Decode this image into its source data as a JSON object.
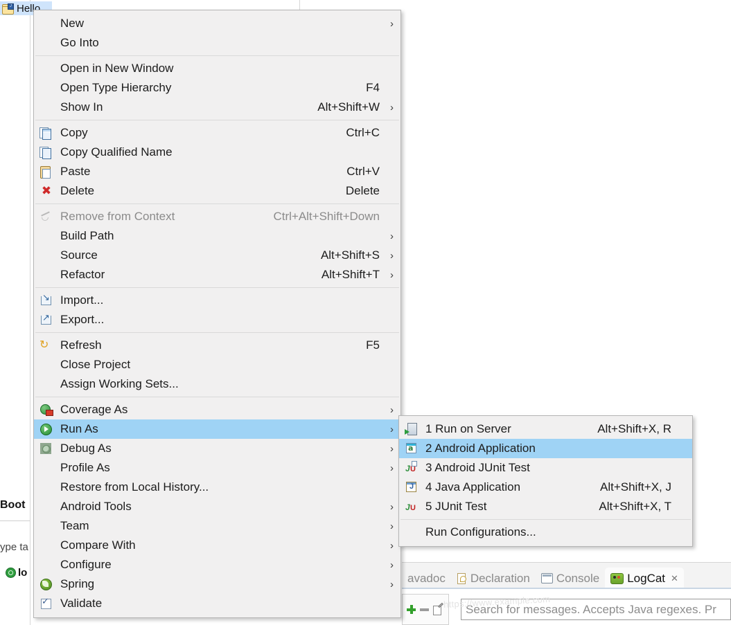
{
  "background": {
    "tree_selected_item": {
      "label": "Hello",
      "icon": "java-project-folder-icon"
    },
    "left_fragments": {
      "boot_label": "Boot",
      "type_label": "ype ta",
      "console_label": "lo",
      "console_icon": "green-circle-icon"
    },
    "view_tabs": [
      {
        "label": "avadoc",
        "icon": "javadoc-icon",
        "active": false,
        "has_close": false
      },
      {
        "label": "Declaration",
        "icon": "declaration-icon",
        "active": false,
        "has_close": false
      },
      {
        "label": "Console",
        "icon": "console-icon",
        "active": false,
        "has_close": false
      },
      {
        "label": "LogCat",
        "icon": "logcat-icon",
        "active": true,
        "has_close": true
      }
    ],
    "tab_close_glyph": "✕",
    "logcat_toolbar": [
      {
        "name": "add-filter-button",
        "icon": "plus-icon"
      },
      {
        "name": "remove-filter-button",
        "icon": "minus-icon"
      },
      {
        "name": "edit-filter-button",
        "icon": "edit-document-icon"
      }
    ],
    "logcat_search_placeholder": "Search for messages. Accepts Java regexes. Pr",
    "watermark": "https://www.example.com"
  },
  "context_menu": {
    "groups": [
      {
        "items": [
          {
            "label": "New",
            "accel": "",
            "submenu": true,
            "icon": "",
            "disabled": false,
            "selected": false
          },
          {
            "label": "Go Into",
            "accel": "",
            "submenu": false,
            "icon": "",
            "disabled": false,
            "selected": false
          }
        ]
      },
      {
        "items": [
          {
            "label": "Open in New Window",
            "accel": "",
            "submenu": false,
            "icon": "",
            "disabled": false,
            "selected": false
          },
          {
            "label": "Open Type Hierarchy",
            "accel": "F4",
            "submenu": false,
            "icon": "",
            "disabled": false,
            "selected": false
          },
          {
            "label": "Show In",
            "accel": "Alt+Shift+W",
            "submenu": true,
            "icon": "",
            "disabled": false,
            "selected": false
          }
        ]
      },
      {
        "items": [
          {
            "label": "Copy",
            "accel": "Ctrl+C",
            "submenu": false,
            "icon": "copy-icon",
            "disabled": false,
            "selected": false
          },
          {
            "label": "Copy Qualified Name",
            "accel": "",
            "submenu": false,
            "icon": "copy-qualified-name-icon",
            "disabled": false,
            "selected": false
          },
          {
            "label": "Paste",
            "accel": "Ctrl+V",
            "submenu": false,
            "icon": "paste-icon",
            "disabled": false,
            "selected": false
          },
          {
            "label": "Delete",
            "accel": "Delete",
            "submenu": false,
            "icon": "delete-x-icon",
            "disabled": false,
            "selected": false
          }
        ]
      },
      {
        "items": [
          {
            "label": "Remove from Context",
            "accel": "Ctrl+Alt+Shift+Down",
            "submenu": false,
            "icon": "remove-from-context-icon",
            "disabled": true,
            "selected": false
          },
          {
            "label": "Build Path",
            "accel": "",
            "submenu": true,
            "icon": "",
            "disabled": false,
            "selected": false
          },
          {
            "label": "Source",
            "accel": "Alt+Shift+S",
            "submenu": true,
            "icon": "",
            "disabled": false,
            "selected": false
          },
          {
            "label": "Refactor",
            "accel": "Alt+Shift+T",
            "submenu": true,
            "icon": "",
            "disabled": false,
            "selected": false
          }
        ]
      },
      {
        "items": [
          {
            "label": "Import...",
            "accel": "",
            "submenu": false,
            "icon": "import-icon",
            "disabled": false,
            "selected": false
          },
          {
            "label": "Export...",
            "accel": "",
            "submenu": false,
            "icon": "export-icon",
            "disabled": false,
            "selected": false
          }
        ]
      },
      {
        "items": [
          {
            "label": "Refresh",
            "accel": "F5",
            "submenu": false,
            "icon": "refresh-icon",
            "disabled": false,
            "selected": false
          },
          {
            "label": "Close Project",
            "accel": "",
            "submenu": false,
            "icon": "",
            "disabled": false,
            "selected": false
          },
          {
            "label": "Assign Working Sets...",
            "accel": "",
            "submenu": false,
            "icon": "",
            "disabled": false,
            "selected": false
          }
        ]
      },
      {
        "items": [
          {
            "label": "Coverage As",
            "accel": "",
            "submenu": true,
            "icon": "coverage-icon",
            "disabled": false,
            "selected": false
          },
          {
            "label": "Run As",
            "accel": "",
            "submenu": true,
            "icon": "run-icon",
            "disabled": false,
            "selected": true
          },
          {
            "label": "Debug As",
            "accel": "",
            "submenu": true,
            "icon": "debug-icon",
            "disabled": false,
            "selected": false
          },
          {
            "label": "Profile As",
            "accel": "",
            "submenu": true,
            "icon": "",
            "disabled": false,
            "selected": false
          },
          {
            "label": "Restore from Local History...",
            "accel": "",
            "submenu": false,
            "icon": "",
            "disabled": false,
            "selected": false
          },
          {
            "label": "Android Tools",
            "accel": "",
            "submenu": true,
            "icon": "",
            "disabled": false,
            "selected": false
          },
          {
            "label": "Team",
            "accel": "",
            "submenu": true,
            "icon": "",
            "disabled": false,
            "selected": false
          },
          {
            "label": "Compare With",
            "accel": "",
            "submenu": true,
            "icon": "",
            "disabled": false,
            "selected": false
          },
          {
            "label": "Configure",
            "accel": "",
            "submenu": true,
            "icon": "",
            "disabled": false,
            "selected": false
          },
          {
            "label": "Spring",
            "accel": "",
            "submenu": true,
            "icon": "spring-icon",
            "disabled": false,
            "selected": false
          },
          {
            "label": "Validate",
            "accel": "",
            "submenu": false,
            "icon": "checkbox-checked-icon",
            "disabled": false,
            "selected": false
          }
        ]
      }
    ]
  },
  "run_as_submenu": {
    "groups": [
      {
        "items": [
          {
            "label": "1 Run on Server",
            "accel": "Alt+Shift+X, R",
            "icon": "run-on-server-icon",
            "selected": false
          },
          {
            "label": "2 Android Application",
            "accel": "",
            "icon": "android-application-icon",
            "selected": true
          },
          {
            "label": "3 Android JUnit Test",
            "accel": "",
            "icon": "android-junit-icon",
            "selected": false
          },
          {
            "label": "4 Java Application",
            "accel": "Alt+Shift+X, J",
            "icon": "java-application-icon",
            "selected": false
          },
          {
            "label": "5 JUnit Test",
            "accel": "Alt+Shift+X, T",
            "icon": "junit-icon",
            "selected": false
          }
        ]
      },
      {
        "items": [
          {
            "label": "Run Configurations...",
            "accel": "",
            "icon": "",
            "selected": false
          }
        ]
      }
    ]
  },
  "glyphs": {
    "submenu_arrow": "›",
    "delete_x": "✖",
    "refresh": "↻"
  },
  "colors": {
    "menu_bg": "#f1f0f0",
    "menu_border": "#b5b5b5",
    "highlight": "#9fd3f5",
    "disabled_text": "#8b8b8b",
    "text": "#1c1c1c",
    "tree_selection": "#cfe4fb"
  }
}
